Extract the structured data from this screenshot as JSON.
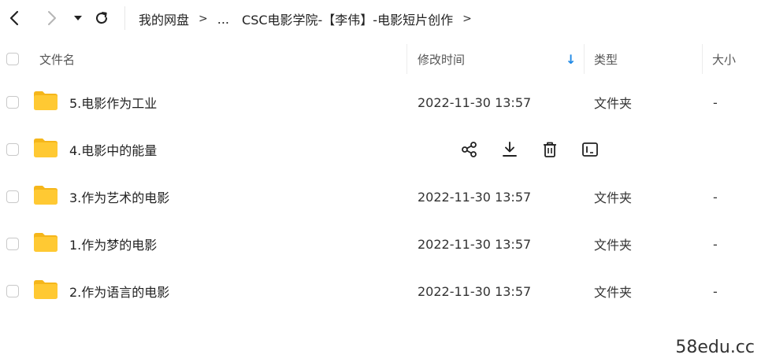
{
  "toolbar": {
    "icons": {
      "back": "chevron-left-icon",
      "forward": "chevron-right-icon",
      "history": "caret-down-icon",
      "refresh": "refresh-icon"
    }
  },
  "breadcrumb": {
    "items": [
      "我的网盘",
      "...",
      "CSC电影学院-【李伟】-电影短片创作"
    ],
    "separator": ">"
  },
  "columns": {
    "name": "文件名",
    "modified": "修改时间",
    "type": "类型",
    "size": "大小",
    "sort_indicator": "↓"
  },
  "files": [
    {
      "name": "5.电影作为工业",
      "modified": "2022-11-30 13:57",
      "type": "文件夹",
      "size": "-"
    },
    {
      "name": "4.电影中的能量",
      "modified": "",
      "type": "",
      "size": "",
      "hovered": true
    },
    {
      "name": "3.作为艺术的电影",
      "modified": "2022-11-30 13:57",
      "type": "文件夹",
      "size": "-"
    },
    {
      "name": "1.作为梦的电影",
      "modified": "2022-11-30 13:57",
      "type": "文件夹",
      "size": "-"
    },
    {
      "name": "2.作为语言的电影",
      "modified": "2022-11-30 13:57",
      "type": "文件夹",
      "size": "-"
    }
  ],
  "row_actions": [
    "share-icon",
    "download-icon",
    "delete-icon",
    "rename-icon"
  ],
  "colors": {
    "folder": "#FFC933",
    "folder_dark": "#F5B61A",
    "accent": "#1E88E5"
  },
  "watermark": "58edu.cc"
}
